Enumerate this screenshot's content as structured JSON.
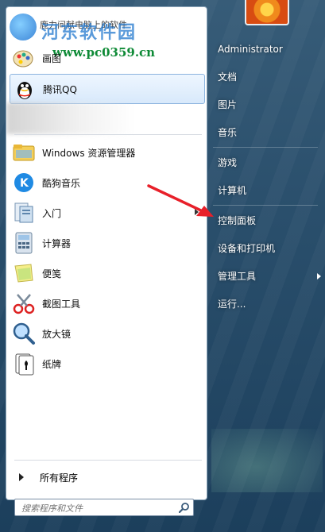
{
  "watermark": {
    "top_text": "鹿力间献电脑上的软件",
    "site_name": "河东软件园",
    "url": "www.pc0359.cn"
  },
  "pinned": [
    {
      "label": "画图",
      "icon": "paint-icon"
    },
    {
      "label": "腾讯QQ",
      "icon": "qq-penguin-icon",
      "highlighted": true
    }
  ],
  "recent": [
    {
      "label": "Windows 资源管理器",
      "icon": "folder-explorer-icon",
      "submenu": false
    },
    {
      "label": "酷狗音乐",
      "icon": "kugou-icon",
      "submenu": false
    },
    {
      "label": "入门",
      "icon": "getting-started-icon",
      "submenu": true
    },
    {
      "label": "计算器",
      "icon": "calculator-icon",
      "submenu": false
    },
    {
      "label": "便笺",
      "icon": "sticky-notes-icon",
      "submenu": false
    },
    {
      "label": "截图工具",
      "icon": "snipping-tool-icon",
      "submenu": false
    },
    {
      "label": "放大镜",
      "icon": "magnifier-icon",
      "submenu": false
    },
    {
      "label": "纸牌",
      "icon": "solitaire-icon",
      "submenu": false
    }
  ],
  "all_programs": "所有程序",
  "search": {
    "placeholder": "搜索程序和文件"
  },
  "right": {
    "user": "Administrator",
    "documents": "文档",
    "pictures": "图片",
    "music": "音乐",
    "games": "游戏",
    "computer": "计算机",
    "control_panel": "控制面板",
    "devices": "设备和打印机",
    "admin_tools": "管理工具",
    "run": "运行..."
  },
  "colors": {
    "highlight_border": "#8cb4df",
    "accent_arrow": "#e8202a",
    "frame": "#2a4f6c"
  }
}
